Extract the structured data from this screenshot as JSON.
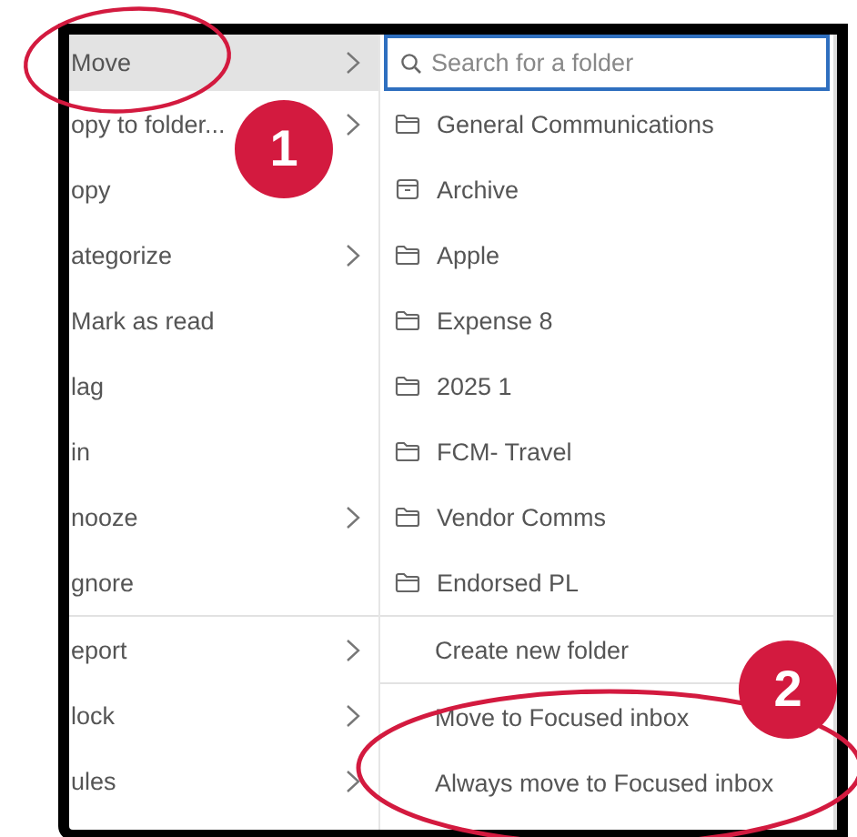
{
  "menu": {
    "items": [
      {
        "label": "Move",
        "selected": true,
        "submenu": true,
        "divider_before": false
      },
      {
        "label": "opy to folder...",
        "selected": false,
        "submenu": true,
        "divider_before": false
      },
      {
        "label": "opy",
        "selected": false,
        "submenu": false,
        "divider_before": false
      },
      {
        "label": "ategorize",
        "selected": false,
        "submenu": true,
        "divider_before": false
      },
      {
        "label": "Mark as read",
        "selected": false,
        "submenu": false,
        "divider_before": false
      },
      {
        "label": "lag",
        "selected": false,
        "submenu": false,
        "divider_before": false
      },
      {
        "label": "in",
        "selected": false,
        "submenu": false,
        "divider_before": false
      },
      {
        "label": "nooze",
        "selected": false,
        "submenu": true,
        "divider_before": false
      },
      {
        "label": "gnore",
        "selected": false,
        "submenu": false,
        "divider_before": false
      },
      {
        "label": "eport",
        "selected": false,
        "submenu": true,
        "divider_before": true
      },
      {
        "label": "lock",
        "selected": false,
        "submenu": true,
        "divider_before": false
      },
      {
        "label": "ules",
        "selected": false,
        "submenu": true,
        "divider_before": false
      }
    ]
  },
  "move_panel": {
    "search": {
      "placeholder": "Search for a folder"
    },
    "folders": [
      {
        "label": "General Communications",
        "kind": "folder"
      },
      {
        "label": "Archive",
        "kind": "archive"
      },
      {
        "label": "Apple",
        "kind": "folder"
      },
      {
        "label": "Expense 8",
        "kind": "folder"
      },
      {
        "label": "2025 1",
        "kind": "folder"
      },
      {
        "label": "FCM- Travel",
        "kind": "folder"
      },
      {
        "label": "Vendor Comms",
        "kind": "folder"
      },
      {
        "label": "Endorsed PL",
        "kind": "folder"
      }
    ],
    "actions": [
      {
        "label": "Create new folder",
        "divider_before": true
      },
      {
        "label": "Move to Focused inbox",
        "divider_before": true
      },
      {
        "label": "Always move to Focused inbox",
        "divider_before": false
      }
    ]
  },
  "annotations": [
    {
      "label": "1"
    },
    {
      "label": "2"
    }
  ]
}
